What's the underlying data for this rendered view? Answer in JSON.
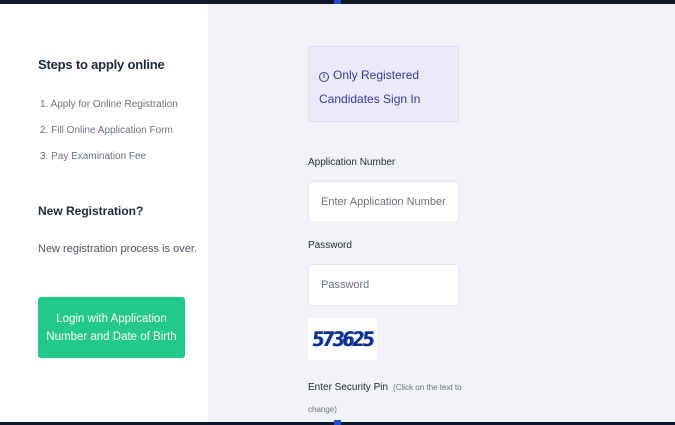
{
  "steps": {
    "title": "Steps to apply online",
    "items": [
      "1. Apply for Online Registration",
      "2. Fill Online Application Form",
      "3. Pay Examination Fee"
    ]
  },
  "new_registration": {
    "title": "New Registration?",
    "text": "New registration process is over."
  },
  "login_button": {
    "label": "Login with Application Number and Date of Birth"
  },
  "notice": {
    "icon": "info-icon",
    "text": "Only Registered Candidates Sign In"
  },
  "form": {
    "application_number": {
      "label": "Application Number",
      "placeholder": "Enter Application Number",
      "value": ""
    },
    "password": {
      "label": "Password",
      "placeholder": "Password",
      "value": ""
    },
    "captcha_text": "573625",
    "security_pin": {
      "label": "Enter Security Pin",
      "hint": "(Click on the text to change)"
    }
  },
  "colors": {
    "accent_green": "#22c98a",
    "notice_bg": "#ebe9fb",
    "notice_text": "#3b3a9a",
    "right_panel_bg": "#f2f3f7"
  }
}
